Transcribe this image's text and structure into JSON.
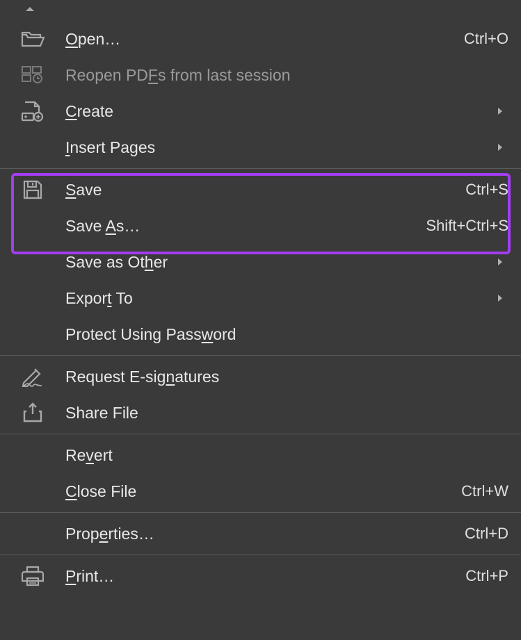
{
  "menu": {
    "open": {
      "label": "Open…",
      "accel": "O",
      "shortcut": "Ctrl+O",
      "has_submenu": false,
      "icon": "folder-open-icon",
      "disabled": false
    },
    "reopen": {
      "label": "Reopen PDFs from last session",
      "accel": "F",
      "shortcut": "",
      "has_submenu": false,
      "icon": "reopen-icon",
      "disabled": true
    },
    "create": {
      "label": "Create",
      "accel": "C",
      "shortcut": "",
      "has_submenu": true,
      "icon": "create-icon",
      "disabled": false
    },
    "insert_pages": {
      "label": "Insert Pages",
      "accel": "I",
      "shortcut": "",
      "has_submenu": true,
      "icon": "",
      "disabled": false
    },
    "save": {
      "label": "Save",
      "accel": "S",
      "shortcut": "Ctrl+S",
      "has_submenu": false,
      "icon": "save-icon",
      "disabled": false
    },
    "save_as": {
      "label": "Save As…",
      "accel": "A",
      "shortcut": "Shift+Ctrl+S",
      "has_submenu": false,
      "icon": "",
      "disabled": false
    },
    "save_as_other": {
      "label": "Save as Other",
      "accel": "h",
      "shortcut": "",
      "has_submenu": true,
      "icon": "",
      "disabled": false
    },
    "export_to": {
      "label": "Export To",
      "accel": "T",
      "shortcut": "",
      "has_submenu": true,
      "icon": "",
      "disabled": false
    },
    "protect": {
      "label": "Protect Using Password",
      "accel": "w",
      "shortcut": "",
      "has_submenu": false,
      "icon": "",
      "disabled": false
    },
    "request_esign": {
      "label": "Request E-signatures",
      "accel": "n",
      "shortcut": "",
      "has_submenu": false,
      "icon": "pen-icon",
      "disabled": false
    },
    "share_file": {
      "label": "Share File",
      "accel": "",
      "shortcut": "",
      "has_submenu": false,
      "icon": "share-icon",
      "disabled": false
    },
    "revert": {
      "label": "Revert",
      "accel": "v",
      "shortcut": "",
      "has_submenu": false,
      "icon": "",
      "disabled": false
    },
    "close_file": {
      "label": "Close File",
      "accel": "C",
      "shortcut": "Ctrl+W",
      "has_submenu": false,
      "icon": "",
      "disabled": false
    },
    "properties": {
      "label": "Properties…",
      "accel": "e",
      "shortcut": "Ctrl+D",
      "has_submenu": false,
      "icon": "",
      "disabled": false
    },
    "print": {
      "label": "Print…",
      "accel": "P",
      "shortcut": "Ctrl+P",
      "has_submenu": false,
      "icon": "print-icon",
      "disabled": false
    }
  }
}
